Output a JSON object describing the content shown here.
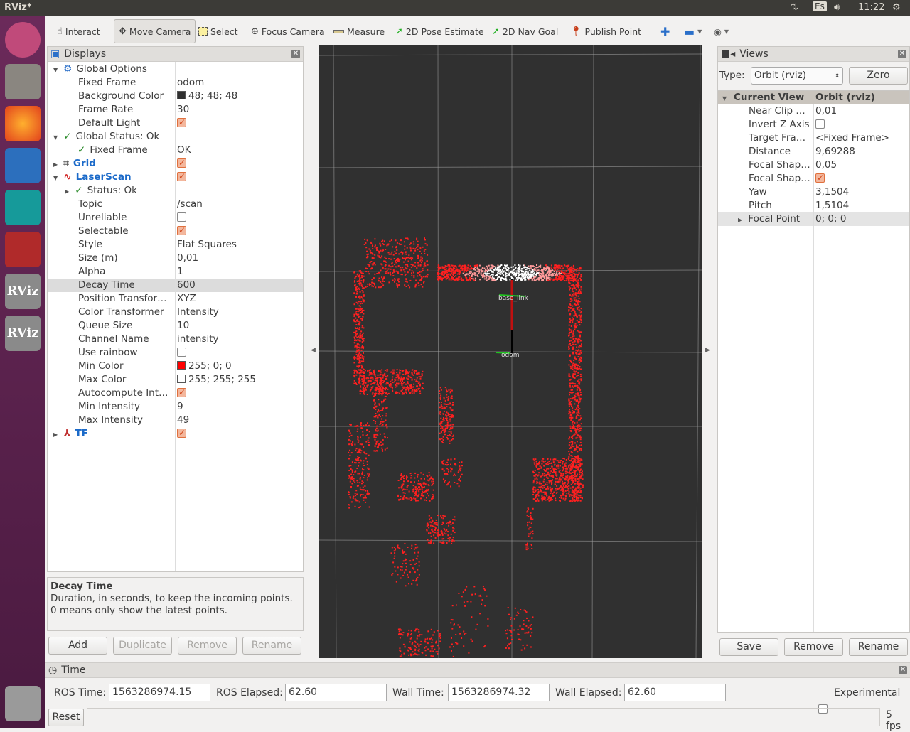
{
  "window": {
    "title": "RViz*"
  },
  "topbar": {
    "lang": "Es",
    "time": "11:22"
  },
  "toolbar": {
    "tools": [
      {
        "label": "Interact",
        "icon": "hand-icon"
      },
      {
        "label": "Move Camera",
        "icon": "move-camera-icon",
        "active": true
      },
      {
        "label": "Select",
        "icon": "select-box-icon"
      },
      {
        "label": "Focus Camera",
        "icon": "crosshair-icon"
      },
      {
        "label": "Measure",
        "icon": "ruler-icon"
      },
      {
        "label": "2D Pose Estimate",
        "icon": "green-arrow-icon"
      },
      {
        "label": "2D Nav Goal",
        "icon": "green-arrow-icon"
      },
      {
        "label": "Publish Point",
        "icon": "map-pin-icon"
      }
    ]
  },
  "displays": {
    "title": "Displays",
    "rows": [
      {
        "label": "Global Options",
        "lvl": 0,
        "exp": "open",
        "icon": "⚙",
        "icolor": "#2a6fc9"
      },
      {
        "label": "Fixed Frame",
        "lvl": 1,
        "value": "odom"
      },
      {
        "label": "Background Color",
        "lvl": 1,
        "value": "48; 48; 48",
        "swatch": "#303030"
      },
      {
        "label": "Frame Rate",
        "lvl": 1,
        "value": "30"
      },
      {
        "label": "Default Light",
        "lvl": 1,
        "check": true
      },
      {
        "label": "Global Status: Ok",
        "lvl": 0,
        "exp": "open",
        "icon": "✓",
        "icolor": "#2a8a2a"
      },
      {
        "label": "Fixed Frame",
        "lvl": 1,
        "value": "OK",
        "icon": "✓",
        "icolor": "#2a8a2a"
      },
      {
        "label": "Grid",
        "lvl": 0,
        "exp": "closed",
        "icon": "⌗",
        "icolor": "#555",
        "blue": true,
        "check": true
      },
      {
        "label": "LaserScan",
        "lvl": 0,
        "exp": "open",
        "icon": "∿",
        "icolor": "#d02020",
        "blue": true,
        "check": true
      },
      {
        "label": "Status: Ok",
        "lvl": 1,
        "exp": "closed",
        "icon": "✓",
        "icolor": "#2a8a2a"
      },
      {
        "label": "Topic",
        "lvl": 1,
        "value": "/scan"
      },
      {
        "label": "Unreliable",
        "lvl": 1,
        "check": false
      },
      {
        "label": "Selectable",
        "lvl": 1,
        "check": true
      },
      {
        "label": "Style",
        "lvl": 1,
        "value": "Flat Squares"
      },
      {
        "label": "Size (m)",
        "lvl": 1,
        "value": "0,01"
      },
      {
        "label": "Alpha",
        "lvl": 1,
        "value": "1"
      },
      {
        "label": "Decay Time",
        "lvl": 1,
        "value": "600",
        "selected": true
      },
      {
        "label": "Position Transfor…",
        "lvl": 1,
        "value": "XYZ"
      },
      {
        "label": "Color Transformer",
        "lvl": 1,
        "value": "Intensity"
      },
      {
        "label": "Queue Size",
        "lvl": 1,
        "value": "10"
      },
      {
        "label": "Channel Name",
        "lvl": 1,
        "value": "intensity"
      },
      {
        "label": "Use rainbow",
        "lvl": 1,
        "check": false
      },
      {
        "label": "Min Color",
        "lvl": 1,
        "value": "255; 0; 0",
        "swatch": "#ff0000"
      },
      {
        "label": "Max Color",
        "lvl": 1,
        "value": "255; 255; 255",
        "swatch": "#ffffff"
      },
      {
        "label": "Autocompute Int…",
        "lvl": 1,
        "check": true
      },
      {
        "label": "Min Intensity",
        "lvl": 1,
        "value": "9"
      },
      {
        "label": "Max Intensity",
        "lvl": 1,
        "value": "49"
      },
      {
        "label": "TF",
        "lvl": 0,
        "exp": "closed",
        "icon": "⅄",
        "icolor": "#c03030",
        "blue": true,
        "check": true
      }
    ],
    "desc_title": "Decay Time",
    "desc_text": "Duration, in seconds, to keep the incoming points. 0 means only show the latest points.",
    "buttons": {
      "add": "Add",
      "duplicate": "Duplicate",
      "remove": "Remove",
      "rename": "Rename"
    }
  },
  "view3d": {
    "frames": [
      "base_link",
      "odom"
    ],
    "colors": {
      "background": "#303030",
      "scan": "#ff2020"
    }
  },
  "views": {
    "title": "Views",
    "type_label": "Type:",
    "type_value": "Orbit (rviz)",
    "zero": "Zero",
    "header": {
      "name": "Current View",
      "value": "Orbit (rviz)"
    },
    "rows": [
      {
        "label": "Near Clip …",
        "value": "0,01"
      },
      {
        "label": "Invert Z Axis",
        "check": false
      },
      {
        "label": "Target Fra…",
        "value": "<Fixed Frame>"
      },
      {
        "label": "Distance",
        "value": "9,69288"
      },
      {
        "label": "Focal Shap…",
        "value": "0,05"
      },
      {
        "label": "Focal Shap…",
        "check": true
      },
      {
        "label": "Yaw",
        "value": "3,1504"
      },
      {
        "label": "Pitch",
        "value": "1,5104"
      },
      {
        "label": "Focal Point",
        "value": "0; 0; 0",
        "exp": "closed",
        "selected": true
      }
    ],
    "buttons": {
      "save": "Save",
      "remove": "Remove",
      "rename": "Rename"
    }
  },
  "time": {
    "title": "Time",
    "ros_time_label": "ROS Time:",
    "ros_time": "1563286974.15",
    "ros_elapsed_label": "ROS Elapsed:",
    "ros_elapsed": "62.60",
    "wall_time_label": "Wall Time:",
    "wall_time": "1563286974.32",
    "wall_elapsed_label": "Wall Elapsed:",
    "wall_elapsed": "62.60",
    "experimental": "Experimental"
  },
  "status": {
    "reset": "Reset",
    "fps": "5 fps"
  }
}
